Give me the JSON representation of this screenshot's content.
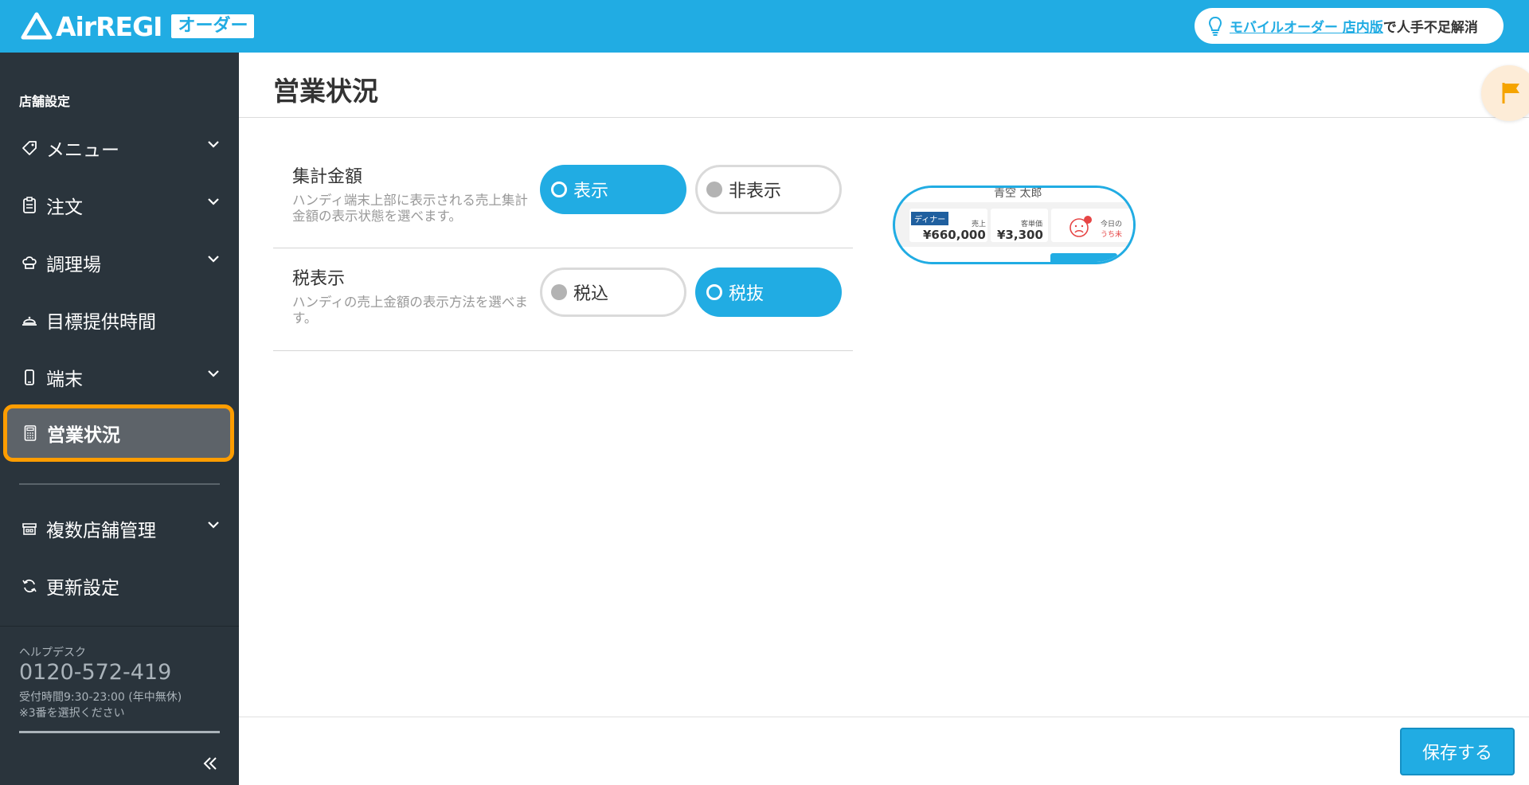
{
  "header": {
    "logo_text": "AirREGI",
    "logo_badge": "オーダー",
    "promo_link": "モバイルオーダー 店内版",
    "promo_tail": "で人手不足解消"
  },
  "sidebar": {
    "section_label": "店舗設定",
    "items": [
      {
        "label": "メニュー",
        "icon": "tag-icon"
      },
      {
        "label": "注文",
        "icon": "clipboard-icon"
      },
      {
        "label": "調理場",
        "icon": "chef-hat-icon"
      },
      {
        "label": "目標提供時間",
        "icon": "cloche-icon"
      },
      {
        "label": "端末",
        "icon": "smartphone-icon"
      },
      {
        "label": "営業状況",
        "icon": "calculator-icon",
        "active": true
      },
      {
        "label": "複数店舗管理",
        "icon": "store-icon"
      },
      {
        "label": "更新設定",
        "icon": "refresh-icon"
      }
    ],
    "help": {
      "label": "ヘルプデスク",
      "phone": "0120-572-419",
      "hours": "受付時間9:30-23:00 (年中無休)",
      "note": "※3番を選択ください"
    }
  },
  "main": {
    "title": "営業状況",
    "settings": [
      {
        "label": "集計金額",
        "desc": "ハンディ端末上部に表示される売上集計金額の表示状態を選べます。",
        "options": [
          "表示",
          "非表示"
        ],
        "selected": "表示"
      },
      {
        "label": "税表示",
        "desc": "ハンディの売上金額の表示方法を選べます。",
        "options": [
          "税込",
          "税抜"
        ],
        "selected": "税抜"
      }
    ],
    "preview": {
      "name": "青空 太郎",
      "tag": "ディナー",
      "sales_label": "売上",
      "sales_value": "¥660,000",
      "avg_label": "客単価",
      "avg_value": "¥3,300",
      "today_label": "今日の",
      "today_sub": "うち未",
      "badge": "未"
    }
  },
  "footer": {
    "save_label": "保存する"
  },
  "colors": {
    "accent": "#21ace3",
    "sidebar_bg": "#2a343c",
    "active_outline": "#ff9d00"
  }
}
